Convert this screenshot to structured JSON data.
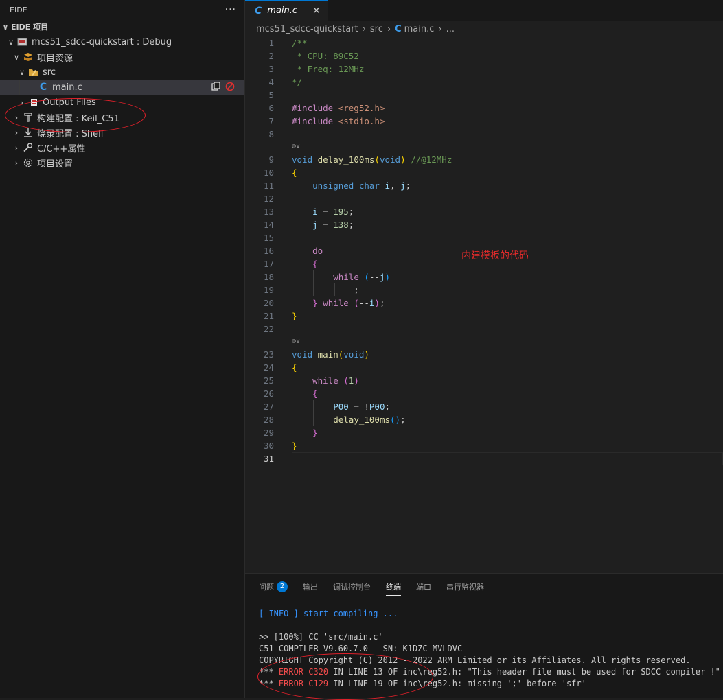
{
  "sidebar": {
    "title": "EIDE",
    "more": "···",
    "section_title": "EIDE 项目",
    "project": "mcs51_sdcc-quickstart : Debug",
    "items": {
      "resources": "项目资源",
      "src": "src",
      "main_c": "main.c",
      "output_files": "Output Files",
      "build_config": "构建配置 : Keil_C51",
      "flash_config": "烧录配置 : Shell",
      "cpp_props": "C/C++属性",
      "project_settings": "项目设置"
    }
  },
  "editor": {
    "tab": "main.c",
    "breadcrumb": {
      "project": "mcs51_sdcc-quickstart",
      "src": "src",
      "file": "main.c",
      "more": "..."
    },
    "annotation": "内建模板的代码",
    "codelens": "⚙∨"
  },
  "code_lines": [
    {
      "n": "1",
      "t": "/**"
    },
    {
      "n": "2",
      "t": " * CPU: 89C52"
    },
    {
      "n": "3",
      "t": " * Freq: 12MHz"
    },
    {
      "n": "4",
      "t": "*/"
    },
    {
      "n": "5",
      "t": ""
    },
    {
      "n": "6",
      "t": "#include <reg52.h>"
    },
    {
      "n": "7",
      "t": "#include <stdio.h>"
    },
    {
      "n": "8",
      "t": ""
    },
    {
      "n": "9",
      "t": "void delay_100ms(void) //@12MHz"
    },
    {
      "n": "10",
      "t": "{"
    },
    {
      "n": "11",
      "t": "    unsigned char i, j;"
    },
    {
      "n": "12",
      "t": ""
    },
    {
      "n": "13",
      "t": "    i = 195;"
    },
    {
      "n": "14",
      "t": "    j = 138;"
    },
    {
      "n": "15",
      "t": ""
    },
    {
      "n": "16",
      "t": "    do"
    },
    {
      "n": "17",
      "t": "    {"
    },
    {
      "n": "18",
      "t": "        while (--j)"
    },
    {
      "n": "19",
      "t": "            ;"
    },
    {
      "n": "20",
      "t": "    } while (--i);"
    },
    {
      "n": "21",
      "t": "}"
    },
    {
      "n": "22",
      "t": ""
    },
    {
      "n": "23",
      "t": "void main(void)"
    },
    {
      "n": "24",
      "t": "{"
    },
    {
      "n": "25",
      "t": "    while (1)"
    },
    {
      "n": "26",
      "t": "    {"
    },
    {
      "n": "27",
      "t": "        P00 = !P00;"
    },
    {
      "n": "28",
      "t": "        delay_100ms();"
    },
    {
      "n": "29",
      "t": "    }"
    },
    {
      "n": "30",
      "t": "}"
    },
    {
      "n": "31",
      "t": ""
    }
  ],
  "panel": {
    "tabs": {
      "problems": "问题",
      "problems_count": "2",
      "output": "输出",
      "debug_console": "调试控制台",
      "terminal": "终端",
      "ports": "端口",
      "serial_monitor": "串行监视器"
    },
    "terminal": {
      "info_open": "[ ",
      "info_tag": "INFO",
      "info_close": " ] ",
      "info_msg": "start compiling ...",
      "cc_line": ">> [100%] CC 'src/main.c'",
      "compiler_line": "C51 COMPILER V9.60.7.0 - SN: K1DZC-MVLDVC",
      "copyright_line": "COPYRIGHT Copyright (C) 2012 - 2022 ARM Limited or its Affiliates. All rights reserved.",
      "err1_prefix": "*** ",
      "err1_code": "ERROR C320",
      "err1_msg": " IN LINE 13 OF inc\\reg52.h: \"This header file must be used for SDCC compiler !\"",
      "err2_prefix": "*** ",
      "err2_code": "ERROR C129",
      "err2_msg": " IN LINE 19 OF inc\\reg52.h: missing ';' before 'sfr'"
    }
  },
  "colors": {
    "accent": "#0078d4",
    "annotation_red": "#e32b2b",
    "error": "#f14c4c"
  }
}
